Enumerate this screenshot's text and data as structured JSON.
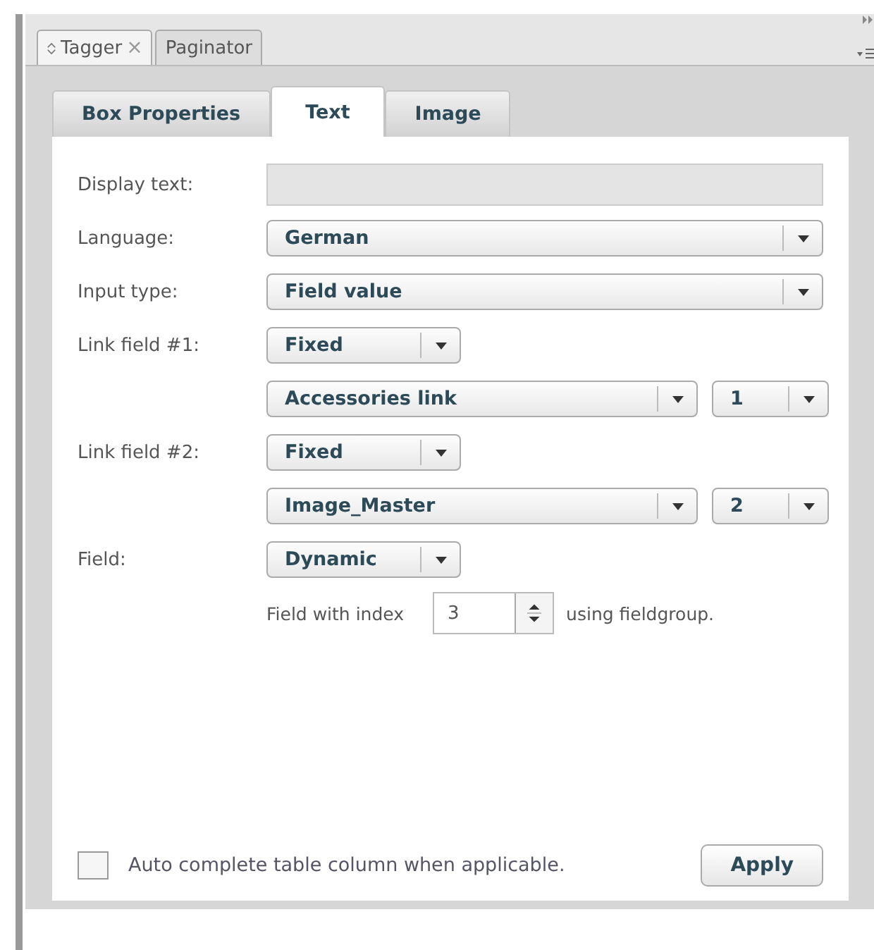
{
  "panel_tabs": [
    {
      "label": "Tagger",
      "close": "×",
      "selected": true
    },
    {
      "label": "Paginator",
      "selected": false
    }
  ],
  "tabs": [
    {
      "label": "Box Properties",
      "selected": false
    },
    {
      "label": "Text",
      "selected": true
    },
    {
      "label": "Image",
      "selected": false
    }
  ],
  "rows": [
    {
      "label": "Display text:",
      "controls": [
        {
          "kind": "text"
        }
      ]
    },
    {
      "label": "Language:",
      "controls": [
        {
          "kind": "wide",
          "value": "German"
        }
      ]
    },
    {
      "label": "Input type:",
      "controls": [
        {
          "kind": "wide",
          "value": "Field value"
        }
      ]
    },
    {
      "label": "Link field #1:",
      "controls": [
        {
          "kind": "short",
          "value": "Fixed"
        }
      ]
    },
    {
      "controls": [
        {
          "kind": "long",
          "value": "Accessories link"
        },
        {
          "kind": "tiny",
          "value": "1"
        }
      ]
    },
    {
      "label": "Link field #2:",
      "controls": [
        {
          "kind": "short",
          "value": "Fixed"
        }
      ]
    },
    {
      "controls": [
        {
          "kind": "long",
          "value": "Image_Master"
        },
        {
          "kind": "tiny",
          "value": "2"
        }
      ]
    },
    {
      "label": "Field:",
      "controls": [
        {
          "kind": "short",
          "value": "Dynamic"
        }
      ]
    }
  ],
  "index_row": {
    "prefix": "Field with index",
    "value": "3",
    "suffix": "using fieldgroup."
  },
  "auto_complete": {
    "label": "Auto complete table column when applicable.",
    "checked": false
  },
  "apply_button": "Apply"
}
